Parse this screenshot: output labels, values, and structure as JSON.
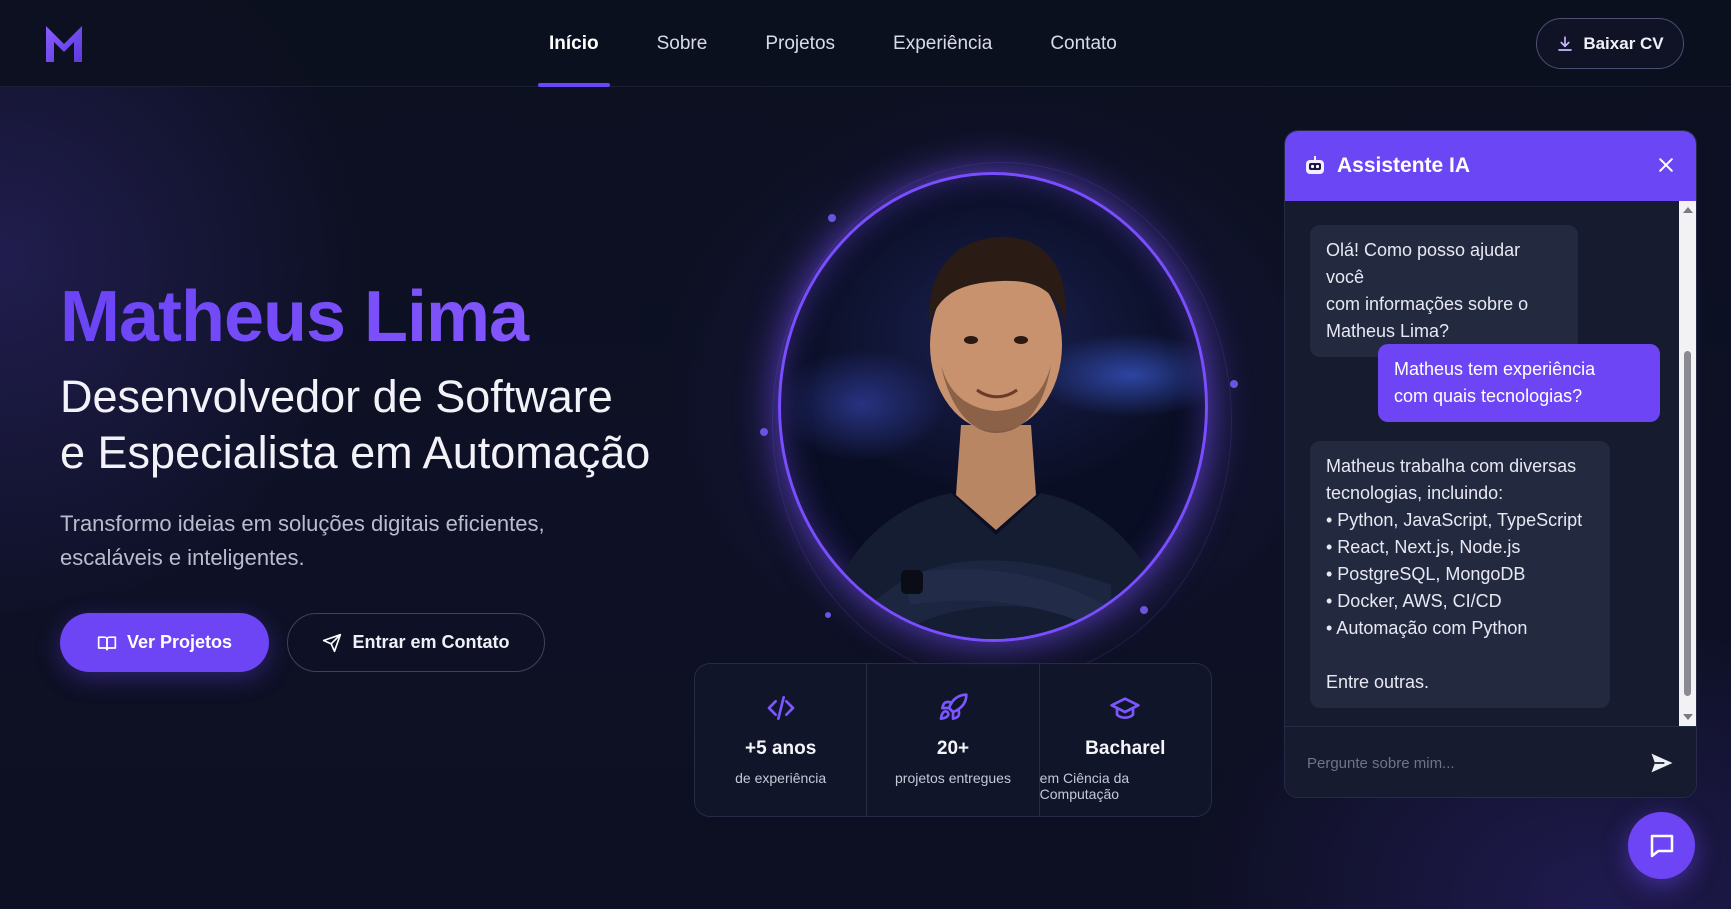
{
  "brand": {
    "logo_icon": "m-logo-icon",
    "accent": "#6d45f5"
  },
  "nav": {
    "links": [
      {
        "label": "Início",
        "active": true
      },
      {
        "label": "Sobre",
        "active": false
      },
      {
        "label": "Projetos",
        "active": false
      },
      {
        "label": "Experiência",
        "active": false
      },
      {
        "label": "Contato",
        "active": false
      }
    ],
    "cv_button": {
      "label": "Baixar CV",
      "icon": "download-icon"
    }
  },
  "hero": {
    "name": "Matheus Lima",
    "role_line1": "Desenvolvedor de Software",
    "role_line2": "e Especialista em Automação",
    "description": "Transformo ideias em soluções digitais eficientes, escaláveis e inteligentes.",
    "primary_button": {
      "label": "Ver Projetos",
      "icon": "book-open-icon"
    },
    "secondary_button": {
      "label": "Entrar em Contato",
      "icon": "send-icon"
    }
  },
  "stats": [
    {
      "icon": "code-icon",
      "value": "+5 anos",
      "label": "de experiência"
    },
    {
      "icon": "rocket-icon",
      "value": "20+",
      "label": "projetos entregues"
    },
    {
      "icon": "graduation-cap-icon",
      "value": "Bacharel",
      "label": "em Ciência da Computação"
    }
  ],
  "chat": {
    "title": "Assistente IA",
    "bot_icon": "robot-icon",
    "messages": [
      {
        "from": "bot",
        "lines": [
          "Olá! Como posso ajudar você",
          "com informações sobre o",
          "Matheus Lima?"
        ]
      },
      {
        "from": "user",
        "lines": [
          "Matheus tem experiência",
          "com quais tecnologias?"
        ]
      },
      {
        "from": "bot",
        "lines": [
          "Matheus trabalha com diversas",
          "tecnologias, incluindo:",
          "• Python, JavaScript, TypeScript",
          "• React, Next.js, Node.js",
          "• PostgreSQL, MongoDB",
          "• Docker, AWS, CI/CD",
          "• Automação com Python",
          "",
          "Entre outras."
        ]
      }
    ],
    "input_placeholder": "Pergunte sobre mim...",
    "send_icon": "send-arrow-icon"
  },
  "fab": {
    "icon": "chat-bubble-icon"
  }
}
